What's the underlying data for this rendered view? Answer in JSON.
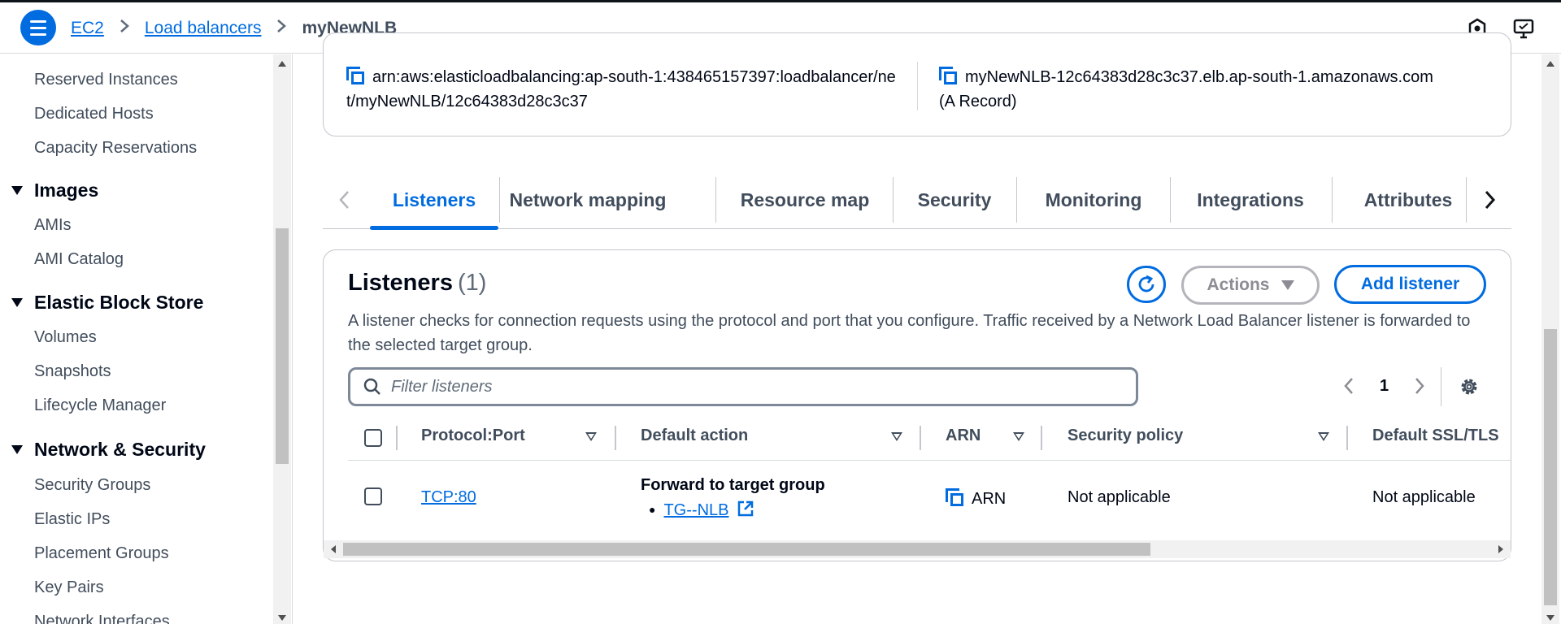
{
  "header": {
    "breadcrumb": [
      "EC2",
      "Load balancers"
    ],
    "current": "myNewNLB",
    "separator": ">"
  },
  "sidebar": {
    "items_top": [
      "Reserved Instances",
      "Dedicated Hosts",
      "Capacity Reservations"
    ],
    "images": {
      "title": "Images",
      "items": [
        "AMIs",
        "AMI Catalog"
      ]
    },
    "ebs": {
      "title": "Elastic Block Store",
      "items": [
        "Volumes",
        "Snapshots",
        "Lifecycle Manager"
      ]
    },
    "network": {
      "title": "Network & Security",
      "items": [
        "Security Groups",
        "Elastic IPs",
        "Placement Groups",
        "Key Pairs",
        "Network Interfaces"
      ]
    }
  },
  "details": {
    "arn": "arn:aws:elasticloadbalancing:ap-south-1:438465157397:loadbalancer/net/myNewNLB/12c64383d28c3c37",
    "dns": "myNewNLB-12c64383d28c3c37.elb.ap-south-1.amazonaws.com",
    "dns_note": "(A Record)"
  },
  "tabs": [
    "Listeners",
    "Network mapping",
    "Resource map",
    "Security",
    "Monitoring",
    "Integrations",
    "Attributes"
  ],
  "active_tab": "Listeners",
  "listeners": {
    "title": "Listeners",
    "count": "(1)",
    "actions_label": "Actions",
    "add_label": "Add listener",
    "description": "A listener checks for connection requests using the protocol and port that you configure. Traffic received by a Network Load Balancer listener is forwarded to the selected target group.",
    "filter_placeholder": "Filter listeners",
    "page": "1",
    "columns": [
      "Protocol:Port",
      "Default action",
      "ARN",
      "Security policy",
      "Default SSL/TLS"
    ],
    "rows": [
      {
        "protocol_port": "TCP:80",
        "default_action": "Forward to target group",
        "target_group": "TG--NLB",
        "arn": "ARN",
        "security_policy": "Not applicable",
        "default_ssl": "Not applicable"
      }
    ]
  },
  "colors": {
    "accent": "#006ce0",
    "text": "#000716",
    "muted": "#414d5c"
  }
}
